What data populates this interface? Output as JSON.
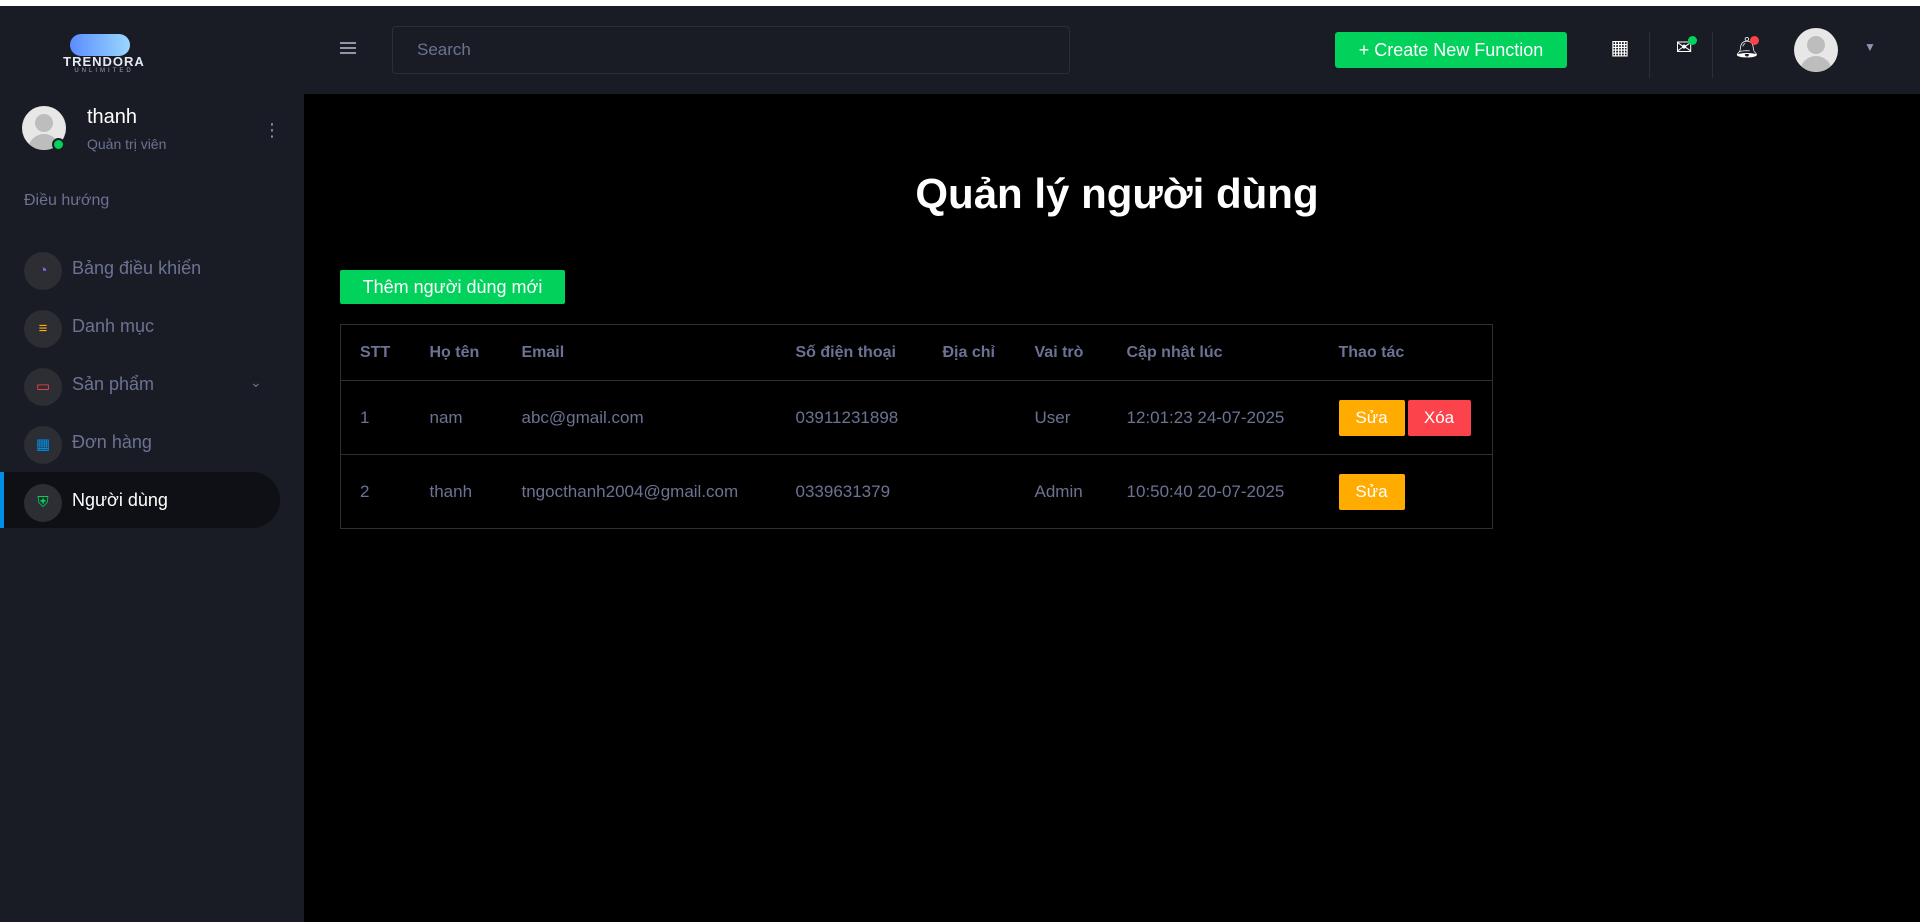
{
  "logo": {
    "word": "TRENDORA",
    "sub": "UNLIMITED"
  },
  "profile": {
    "name": "thanh",
    "role": "Quản trị viên"
  },
  "sidebar": {
    "heading": "Điều hướng",
    "items": [
      {
        "label": "Bảng điều khiển",
        "icon": "speedometer-icon",
        "color": "#8f5fe8"
      },
      {
        "label": "Danh mục",
        "icon": "list-icon",
        "color": "#ffab00"
      },
      {
        "label": "Sản phẩm",
        "icon": "laptop-icon",
        "color": "#fc424a"
      },
      {
        "label": "Đơn hàng",
        "icon": "table-icon",
        "color": "#0090e7"
      },
      {
        "label": "Người dùng",
        "icon": "shield-icon",
        "color": "#00d25b"
      }
    ]
  },
  "navbar": {
    "search_placeholder": "Search",
    "create_label": "+ Create New Function"
  },
  "main": {
    "title": "Quản lý người dùng",
    "add_label": "Thêm người dùng mới",
    "table": {
      "headers": [
        "STT",
        "Họ tên",
        "Email",
        "Số điện thoại",
        "Địa chỉ",
        "Vai trò",
        "Cập nhật lúc",
        "Thao tác"
      ],
      "rows": [
        {
          "stt": "1",
          "name": "nam",
          "email": "abc@gmail.com",
          "phone": "03911231898",
          "address": "",
          "role": "User",
          "updated": "12:01:23 24-07-2025",
          "edit": "Sửa",
          "delete": "Xóa"
        },
        {
          "stt": "2",
          "name": "thanh",
          "email": "tngocthanh2004@gmail.com",
          "phone": "0339631379",
          "address": "",
          "role": "Admin",
          "updated": "10:50:40 20-07-2025",
          "edit": "Sửa"
        }
      ]
    }
  },
  "colors": {
    "accent_green": "#00d25b",
    "warning": "#ffab00",
    "danger": "#fc424a",
    "sidebar_bg": "#191c24"
  }
}
